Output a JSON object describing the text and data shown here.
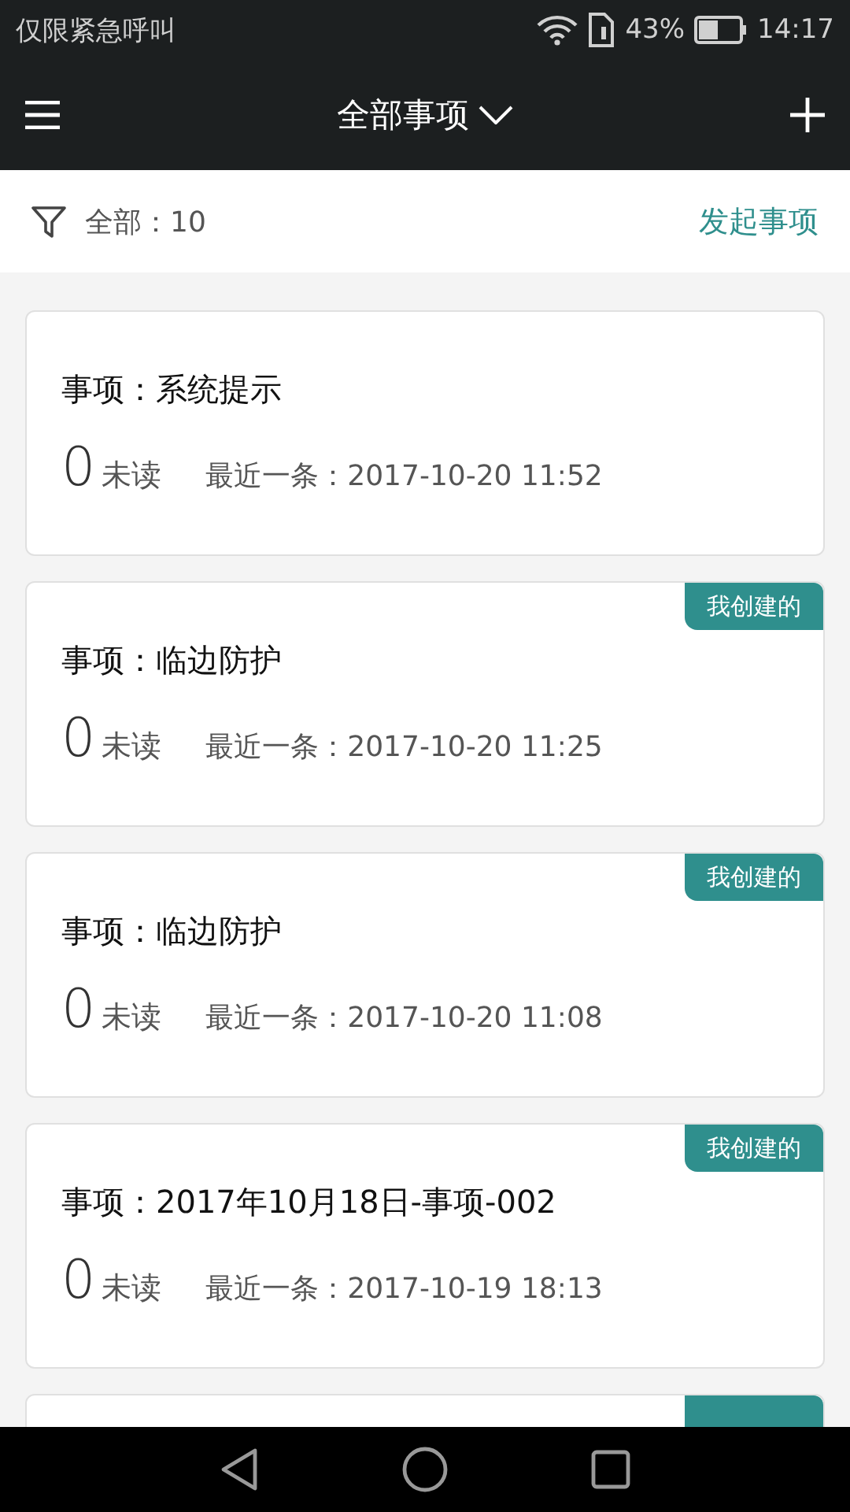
{
  "status_bar": {
    "carrier": "仅限紧急呼叫",
    "battery": "43%",
    "time": "14:17"
  },
  "app_bar": {
    "title": "全部事项"
  },
  "filter_bar": {
    "summary": "全部：10",
    "action": "发起事项"
  },
  "cards": [
    {
      "title": "事项：系统提示",
      "unread_count": "0",
      "unread_label": "未读",
      "latest": "最近一条：2017-10-20 11:52"
    },
    {
      "tag": "我创建的",
      "title": "事项：临边防护",
      "unread_count": "0",
      "unread_label": "未读",
      "latest": "最近一条：2017-10-20 11:25"
    },
    {
      "tag": "我创建的",
      "title": "事项：临边防护",
      "unread_count": "0",
      "unread_label": "未读",
      "latest": "最近一条：2017-10-20 11:08"
    },
    {
      "tag": "我创建的",
      "title": "事项：2017年10月18日-事项-002",
      "unread_count": "0",
      "unread_label": "未读",
      "latest": "最近一条：2017-10-19 18:13"
    },
    {
      "tagged": true
    }
  ]
}
